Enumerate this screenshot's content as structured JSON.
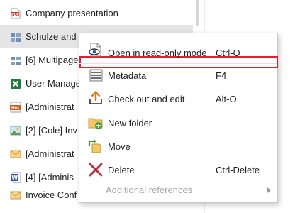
{
  "file_list": {
    "items": [
      {
        "label": "Company presentation",
        "icon": "pdf-icon"
      },
      {
        "label": "Schulze and Par Co",
        "icon": "archive-icon"
      },
      {
        "label": "[6] Multipage",
        "icon": "archive-icon"
      },
      {
        "label": "User Manage",
        "icon": "excel-icon"
      },
      {
        "label": "[Administrat",
        "icon": "png-icon"
      },
      {
        "label": "[2] [Cole] Inv",
        "icon": "image-icon"
      },
      {
        "label": "[Administrat",
        "icon": "mail-icon"
      },
      {
        "label": "[4] [Adminis",
        "icon": "word-icon"
      },
      {
        "label": "Invoice Conf",
        "icon": "mail-icon"
      }
    ]
  },
  "context_menu": {
    "items": [
      {
        "label": "Open in read-only mode",
        "shortcut": "Ctrl-O",
        "icon": "eye-icon"
      },
      {
        "label": "Metadata",
        "shortcut": "F4",
        "icon": "metadata-icon"
      },
      {
        "label": "Check out and edit",
        "shortcut": "Alt-O",
        "icon": "check-out-icon"
      },
      {
        "label": "New folder",
        "shortcut": "",
        "icon": "new-folder-icon"
      },
      {
        "label": "Move",
        "shortcut": "",
        "icon": "move-icon"
      },
      {
        "label": "Delete",
        "shortcut": "Ctrl-Delete",
        "icon": "delete-icon"
      },
      {
        "label": "Additional references",
        "shortcut": "",
        "icon": "chevron-right-icon"
      }
    ]
  },
  "colors": {
    "focus_outline": "#e0202a",
    "selected_row": "#e5e5e5",
    "disabled_text": "#a8a8a8"
  }
}
